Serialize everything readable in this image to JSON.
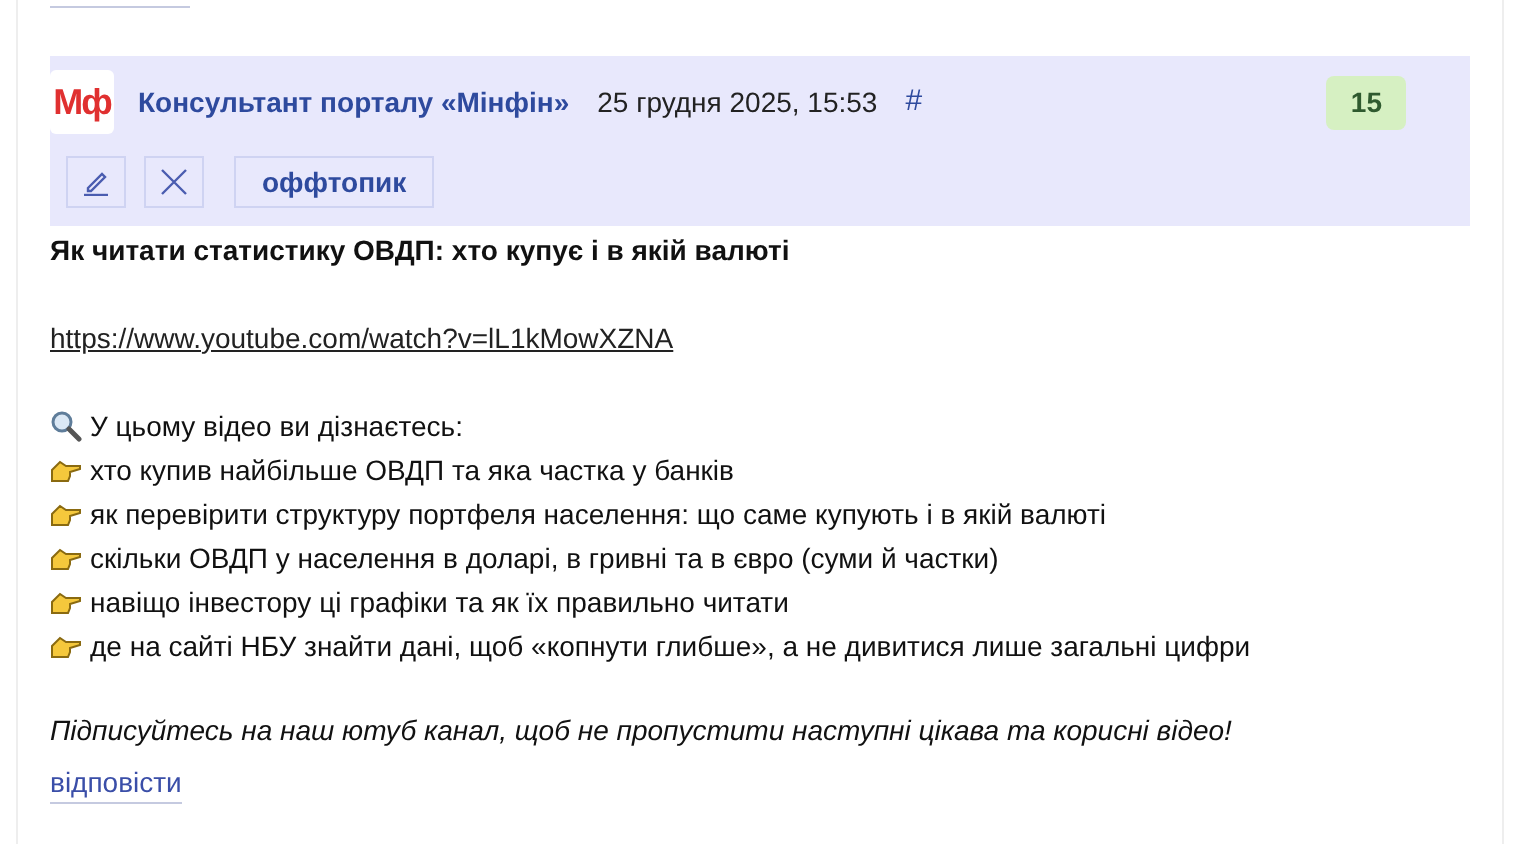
{
  "comment": {
    "logo": "Мф",
    "author": "Консультант порталу «Мінфін»",
    "date": "25 грудня 2025, 15:53",
    "anchor": "#",
    "rating": "15",
    "actions": [
      "оффтопик"
    ],
    "title": "Як читати статистику ОВДП: хто купує і в якій валюті",
    "link": "https://www.youtube.com/watch?v=lL1kMowXZNA",
    "intro": "У цьому відео ви дізнаєтесь:",
    "points": [
      "хто купив найбільше ОВДП та яка частка у банків",
      "як перевірити структуру портфеля населення: що саме купують і в якій валюті",
      "скільки ОВДП у населення в доларі, в гривні та в євро (суми й частки)",
      "навіщо інвестору ці графіки та як їх правильно читати",
      "де на сайті НБУ знайти дані, щоб «копнути глибше», а не дивитися лише загальні цифри"
    ],
    "outro": "Підписуйтесь на наш ютуб канал, щоб не пропустити наступні цікава та корисні відео!",
    "reply": "відповісти"
  }
}
